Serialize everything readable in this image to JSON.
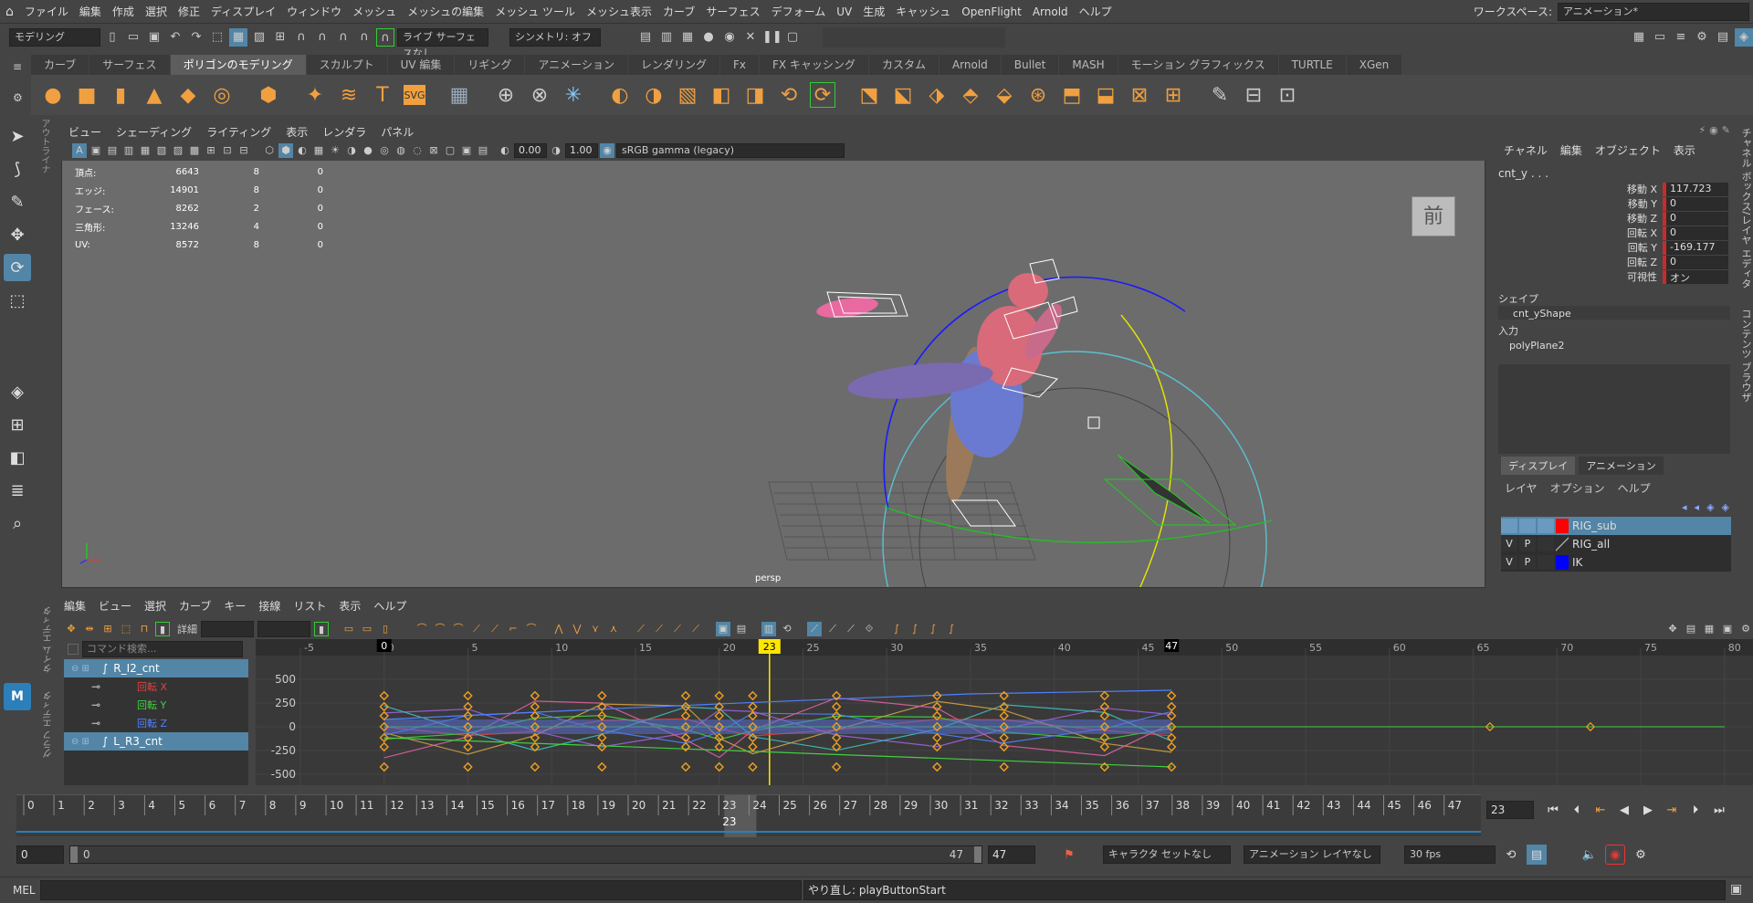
{
  "menubar": {
    "items": [
      "ファイル",
      "編集",
      "作成",
      "選択",
      "修正",
      "ディスプレイ",
      "ウィンドウ",
      "メッシュ",
      "メッシュの編集",
      "メッシュ ツール",
      "メッシュ表示",
      "カーブ",
      "サーフェス",
      "デフォーム",
      "UV",
      "生成",
      "キャッシュ",
      "OpenFlight",
      "Arnold",
      "ヘルプ"
    ],
    "workspace_label": "ワークスペース:",
    "workspace_value": "アニメーション*"
  },
  "statusline": {
    "mode": "モデリング",
    "live_surface": "ライブ サーフェスなし",
    "symmetry": "シンメトリ: オフ"
  },
  "shelf": {
    "tabs": [
      "カーブ",
      "サーフェス",
      "ポリゴンのモデリング",
      "スカルプト",
      "UV 編集",
      "リギング",
      "アニメーション",
      "レンダリング",
      "Fx",
      "FX キャッシング",
      "カスタム",
      "Arnold",
      "Bullet",
      "MASH",
      "モーション グラフィックス",
      "TURTLE",
      "XGen"
    ],
    "active_index": 2
  },
  "outliner_tab": "アウトライナ",
  "viewport": {
    "menu": [
      "ビュー",
      "シェーディング",
      "ライティング",
      "表示",
      "レンダラ",
      "パネル"
    ],
    "exposure": "0.00",
    "gamma": "1.00",
    "color_space": "sRGB gamma (legacy)",
    "hud": [
      {
        "label": "頂点:",
        "v1": "6643",
        "v2": "8",
        "v3": "0"
      },
      {
        "label": "エッジ:",
        "v1": "14901",
        "v2": "8",
        "v3": "0"
      },
      {
        "label": "フェース:",
        "v1": "8262",
        "v2": "2",
        "v3": "0"
      },
      {
        "label": "三角形:",
        "v1": "13246",
        "v2": "4",
        "v3": "0"
      },
      {
        "label": "UV:",
        "v1": "8572",
        "v2": "8",
        "v3": "0"
      }
    ],
    "view_cube_label": "前",
    "camera": "persp"
  },
  "channel_box": {
    "menu": [
      "チャネル",
      "編集",
      "オブジェクト",
      "表示"
    ],
    "object": "cnt_y . . .",
    "attributes": [
      {
        "name": "移動 X",
        "value": "117.723"
      },
      {
        "name": "移動 Y",
        "value": "0"
      },
      {
        "name": "移動 Z",
        "value": "0"
      },
      {
        "name": "回転 X",
        "value": "0"
      },
      {
        "name": "回転 Y",
        "value": "-169.177"
      },
      {
        "name": "回転 Z",
        "value": "0"
      },
      {
        "name": "可視性",
        "value": "オン"
      }
    ],
    "shapes_label": "シェイプ",
    "shape": "cnt_yShape",
    "inputs_label": "入力",
    "input": "polyPlane2",
    "side_tabs": "チャネル ボックス/レイヤ エディタ　　コンテンツ ブラウザ"
  },
  "layer_editor": {
    "tabs": [
      "ディスプレイ",
      "アニメーション"
    ],
    "menu": [
      "レイヤ",
      "オプション",
      "ヘルプ"
    ],
    "layers": [
      {
        "v": "",
        "p": "",
        "name": "RIG_sub",
        "color": "#ff0000"
      },
      {
        "v": "V",
        "p": "P",
        "name": "RIG_all",
        "color": ""
      },
      {
        "v": "V",
        "p": "P",
        "name": "IK",
        "color": "#0000ff"
      }
    ]
  },
  "graph_editor": {
    "side_label": "グラフ エディタ　　タイム エディタ",
    "menu": [
      "編集",
      "ビュー",
      "選択",
      "カーブ",
      "キー",
      "接線",
      "リスト",
      "表示",
      "ヘルプ"
    ],
    "detail_label": "詳細",
    "search_placeholder": "コマンド検索...",
    "outliner": [
      {
        "name": "R_I2_cnt",
        "hl": true,
        "color": "#fff"
      },
      {
        "name": "回転 X",
        "hl": false,
        "color": "#e04040"
      },
      {
        "name": "回転 Y",
        "hl": false,
        "color": "#40d040"
      },
      {
        "name": "回転 Z",
        "hl": false,
        "color": "#5080ff"
      },
      {
        "name": "L_R3_cnt",
        "hl": true,
        "color": "#fff"
      }
    ],
    "frame_ticks": [
      "-5",
      "0",
      "5",
      "10",
      "15",
      "20",
      "25",
      "30",
      "35",
      "40",
      "45",
      "50",
      "55",
      "60",
      "65",
      "70",
      "75",
      "80"
    ],
    "value_ticks": [
      "500",
      "250",
      "0",
      "-250",
      "-500"
    ],
    "current_frame": "23",
    "start_marker": "0",
    "end_marker": "47"
  },
  "timeslider": {
    "frames": [
      "0",
      "1",
      "2",
      "3",
      "4",
      "5",
      "6",
      "7",
      "8",
      "9",
      "10",
      "11",
      "12",
      "13",
      "14",
      "15",
      "16",
      "17",
      "18",
      "19",
      "20",
      "21",
      "22",
      "23",
      "24",
      "25",
      "26",
      "27",
      "28",
      "29",
      "30",
      "31",
      "32",
      "33",
      "34",
      "35",
      "36",
      "37",
      "38",
      "39",
      "40",
      "41",
      "42",
      "43",
      "44",
      "45",
      "46",
      "47"
    ],
    "current": "23",
    "current_field": "23"
  },
  "range": {
    "start": "0",
    "inner_start": "0",
    "inner_end": "47",
    "end": "47",
    "character_set": "キャラクタ セットなし",
    "anim_layer": "アニメーション レイヤなし",
    "fps": "30 fps"
  },
  "cmdline": {
    "label": "MEL",
    "result": "やり直し: playButtonStart"
  },
  "colors": {
    "accent": "#5285a6",
    "key": "#f0a020",
    "current_time": "#ffe600"
  }
}
